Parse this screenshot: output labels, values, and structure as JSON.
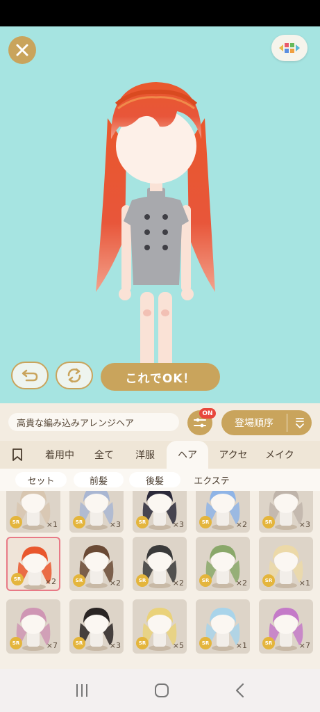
{
  "toolbar": {
    "ok_label": "これでOK！"
  },
  "filter": {
    "item_name": "高貴な編み込みアレンジヘア",
    "badge": "ON",
    "sort_label": "登場順序"
  },
  "category_tabs": [
    {
      "label": ""
    },
    {
      "label": "着用中"
    },
    {
      "label": "全て"
    },
    {
      "label": "洋服"
    },
    {
      "label": "ヘア"
    },
    {
      "label": "アクセ"
    },
    {
      "label": "メイク"
    }
  ],
  "sub_tabs": [
    {
      "label": "セット"
    },
    {
      "label": "前髪"
    },
    {
      "label": "後髪"
    },
    {
      "label": "エクステ"
    }
  ],
  "items": [
    {
      "rarity": "SR",
      "count": "×1",
      "hair": "#d8c6b0"
    },
    {
      "rarity": "SR",
      "count": "×3",
      "hair": "#a9b6d2"
    },
    {
      "rarity": "SR",
      "count": "×3",
      "hair": "#2c2a3a"
    },
    {
      "rarity": "SR",
      "count": "×2",
      "hair": "#8fb4e6"
    },
    {
      "rarity": "SR",
      "count": "×3",
      "hair": "#bfb4aa"
    },
    {
      "rarity": "SR",
      "count": "×2",
      "hair": "#e9572d"
    },
    {
      "rarity": "SR",
      "count": "×2",
      "hair": "#6a4a35"
    },
    {
      "rarity": "SR",
      "count": "×2",
      "hair": "#3a3a3a"
    },
    {
      "rarity": "SR",
      "count": "×2",
      "hair": "#8aa86a"
    },
    {
      "rarity": "SR",
      "count": "×1",
      "hair": "#ecd9a8"
    },
    {
      "rarity": "SR",
      "count": "×7",
      "hair": "#cf96b4"
    },
    {
      "rarity": "SR",
      "count": "×3",
      "hair": "#2a2524"
    },
    {
      "rarity": "SR",
      "count": "×5",
      "hair": "#ead27a"
    },
    {
      "rarity": "SR",
      "count": "×1",
      "hair": "#a9d4ea"
    },
    {
      "rarity": "SR",
      "count": "×7",
      "hair": "#c47ac8"
    }
  ],
  "colors": {
    "stage_bg": "#a6e4e1",
    "accent_gold": "#c9a45c",
    "selected_border": "#e87a86",
    "badge_red": "#e8473c"
  }
}
